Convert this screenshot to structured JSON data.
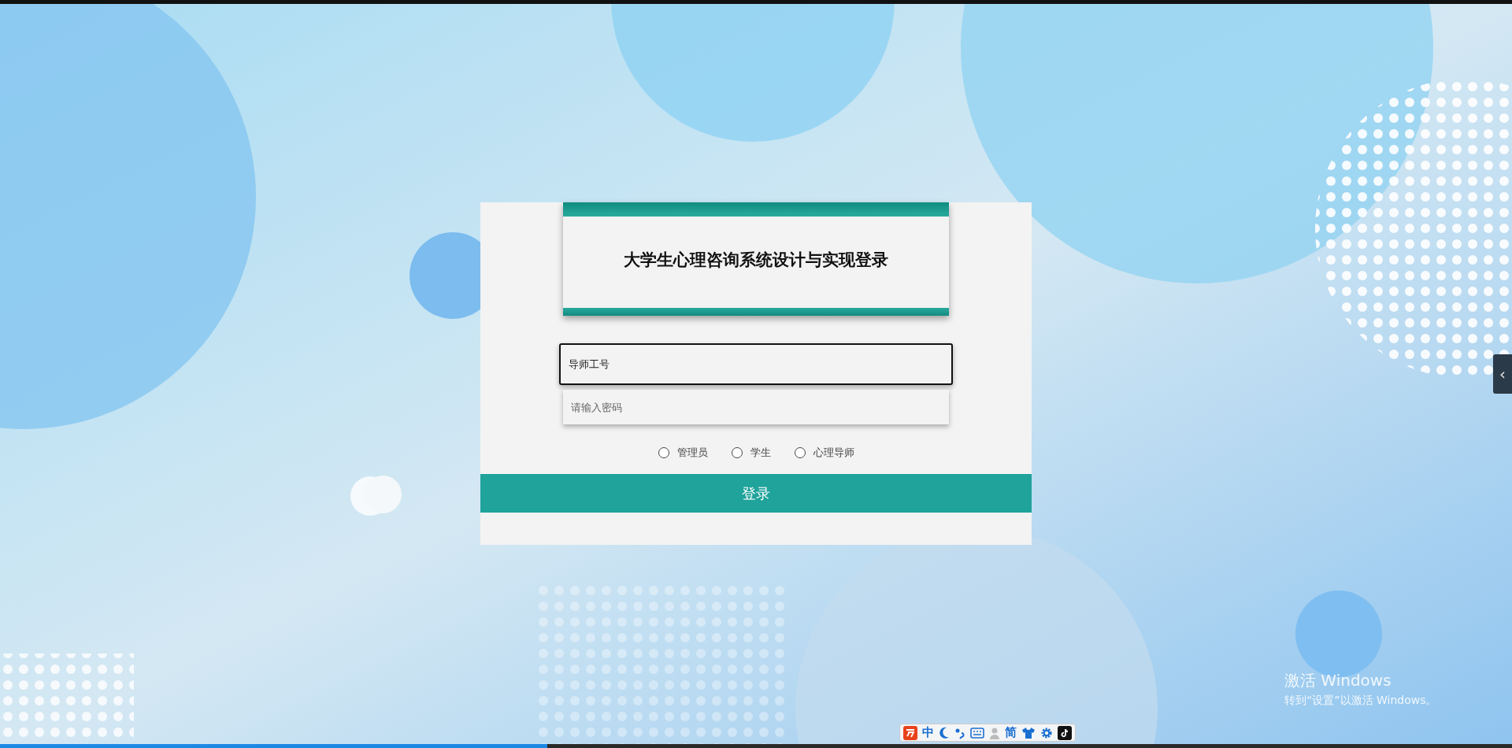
{
  "login": {
    "title": "大学生心理咨询系统设计与实现登录",
    "username": {
      "value": "导师工号",
      "focused": true
    },
    "password": {
      "placeholder": "请输入密码"
    },
    "roles": [
      {
        "label": "管理员",
        "selected": false
      },
      {
        "label": "学生",
        "selected": false
      },
      {
        "label": "心理导师",
        "selected": false
      }
    ],
    "submit": "登录"
  },
  "side_tab": {
    "icon": "‹"
  },
  "ime_toolbar": {
    "items": [
      {
        "kind": "logo"
      },
      {
        "kind": "text",
        "label": "中"
      },
      {
        "kind": "moon"
      },
      {
        "kind": "punct"
      },
      {
        "kind": "keyboard"
      },
      {
        "kind": "person"
      },
      {
        "kind": "text",
        "label": "简"
      },
      {
        "kind": "shirt"
      },
      {
        "kind": "gear"
      },
      {
        "kind": "note"
      }
    ]
  },
  "activation": {
    "title": "激活 Windows",
    "hint": "转到“设置”以激活 Windows。"
  },
  "video_progress": {
    "level": 0.362
  }
}
